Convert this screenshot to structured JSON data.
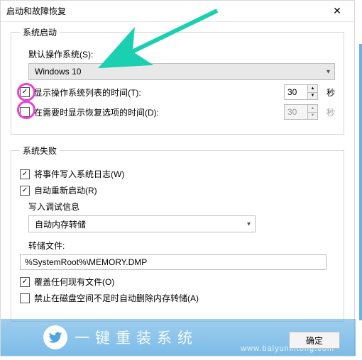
{
  "window": {
    "title": "启动和故障恢复",
    "close": "✕"
  },
  "startup": {
    "legend": "系统启动",
    "default_os_label": "默认操作系统(S):",
    "default_os_value": "Windows 10",
    "show_os_list": {
      "checked": true,
      "label": "显示操作系统列表的时间(T):",
      "value": "30",
      "unit": "秒"
    },
    "show_recovery": {
      "checked": false,
      "label": "在需要时显示恢复选项的时间(D):",
      "value": "30",
      "unit": "秒"
    }
  },
  "failure": {
    "legend": "系统失败",
    "log_event": {
      "checked": true,
      "label": "将事件写入系统日志(W)"
    },
    "auto_restart": {
      "checked": true,
      "label": "自动重新启动(R)"
    },
    "debug_section_label": "写入调试信息",
    "debug_select_value": "自动内存转储",
    "dump_file_label": "转储文件:",
    "dump_file_value": "%SystemRoot%\\MEMORY.DMP",
    "overwrite": {
      "checked": true,
      "label": "覆盖任何现有文件(O)"
    },
    "disable_low_disk": {
      "checked": false,
      "label": "禁止在磁盘空间不足时自动删除内存转储(A)"
    }
  },
  "buttons": {
    "ok": "确定"
  },
  "watermark": {
    "cn": "一键重装系统",
    "en": "www.baiyunxitong.com"
  }
}
